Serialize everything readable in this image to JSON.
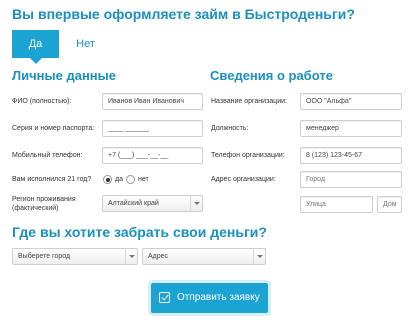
{
  "questions": {
    "first_time": "Вы впервые оформляете займ в Быстроденьги?",
    "where_money": "Где вы хотите забрать свои деньги?"
  },
  "tabs": {
    "yes": "Да",
    "no": "Нет"
  },
  "personal": {
    "title": "Личные данные",
    "fio_label": "ФИО (полностью):",
    "fio_value": "Иванов Иван Иванович",
    "passport_label": "Серия и номер паспорта:",
    "passport_value": "____ ______",
    "phone_label": "Мобильный телефон:",
    "phone_value": "+7 (___) ___-__-__",
    "age_label": "Вам исполнился 21 год?",
    "age_yes": "да",
    "age_no": "нет",
    "age_selected": "да",
    "region_label_1": "Регион проживания",
    "region_label_2": "(фактический)",
    "region_value": "Алтайский край"
  },
  "work": {
    "title": "Сведения о работе",
    "org_label": "Название организации:",
    "org_value": "ООО \"Альфа\"",
    "position_label": "Должность:",
    "position_value": "менеджер",
    "org_phone_label": "Телефон организации:",
    "org_phone_value": "8 (123) 123-45-67",
    "address_label": "Адрес организации:",
    "city_placeholder": "Город",
    "street_placeholder": "Улица",
    "house_placeholder": "Дом"
  },
  "payout": {
    "city_select": "Выберете город",
    "address_select": "Адрес"
  },
  "submit_label": "Отправить заявку",
  "colors": {
    "accent": "#1ba3d4",
    "heading": "#1a8fc0"
  }
}
